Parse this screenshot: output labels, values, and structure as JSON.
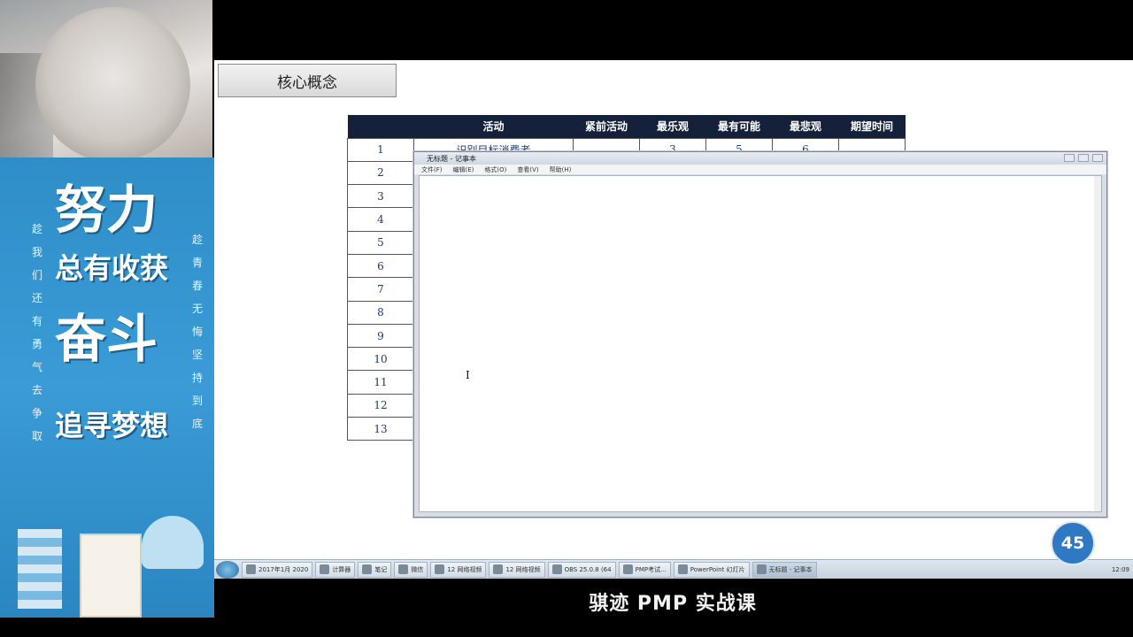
{
  "promo": {
    "line1": "努力",
    "line2": "总有收获",
    "line3": "奋斗",
    "line4": "追寻梦想",
    "left_column": "趁我们还有勇气去争取",
    "right_column": "趁青春无悔坚持到底"
  },
  "slide": {
    "core_label": "核心概念",
    "table": {
      "headers": [
        "",
        "活动",
        "紧前活动",
        "最乐观",
        "最有可能",
        "最悲观",
        "期望时间"
      ],
      "rows": [
        {
          "num": "1",
          "activity": "识别目标消费者",
          "optimistic": "3",
          "likely": "5",
          "pessimistic": "6"
        },
        {
          "num": "2"
        },
        {
          "num": "3"
        },
        {
          "num": "4"
        },
        {
          "num": "5"
        },
        {
          "num": "6"
        },
        {
          "num": "7"
        },
        {
          "num": "8"
        },
        {
          "num": "9"
        },
        {
          "num": "10"
        },
        {
          "num": "11"
        },
        {
          "num": "12"
        },
        {
          "num": "13"
        }
      ]
    }
  },
  "notepad": {
    "title": "无标题 - 记事本",
    "menu": [
      "文件(F)",
      "编辑(E)",
      "格式(O)",
      "查看(V)",
      "帮助(H)"
    ],
    "caret": "I"
  },
  "taskbar": {
    "items": [
      "2017年1月 2020",
      "计算器",
      "笔记",
      "微信",
      "12 网络视频",
      "12 网络视频",
      "OBS 25.0.8 (64",
      "PMP考试...",
      "PowerPoint 幻灯片",
      "无标题 - 记事本"
    ],
    "tray": "12:09"
  },
  "badge": "45",
  "caption": "骐迹 PMP 实战课"
}
